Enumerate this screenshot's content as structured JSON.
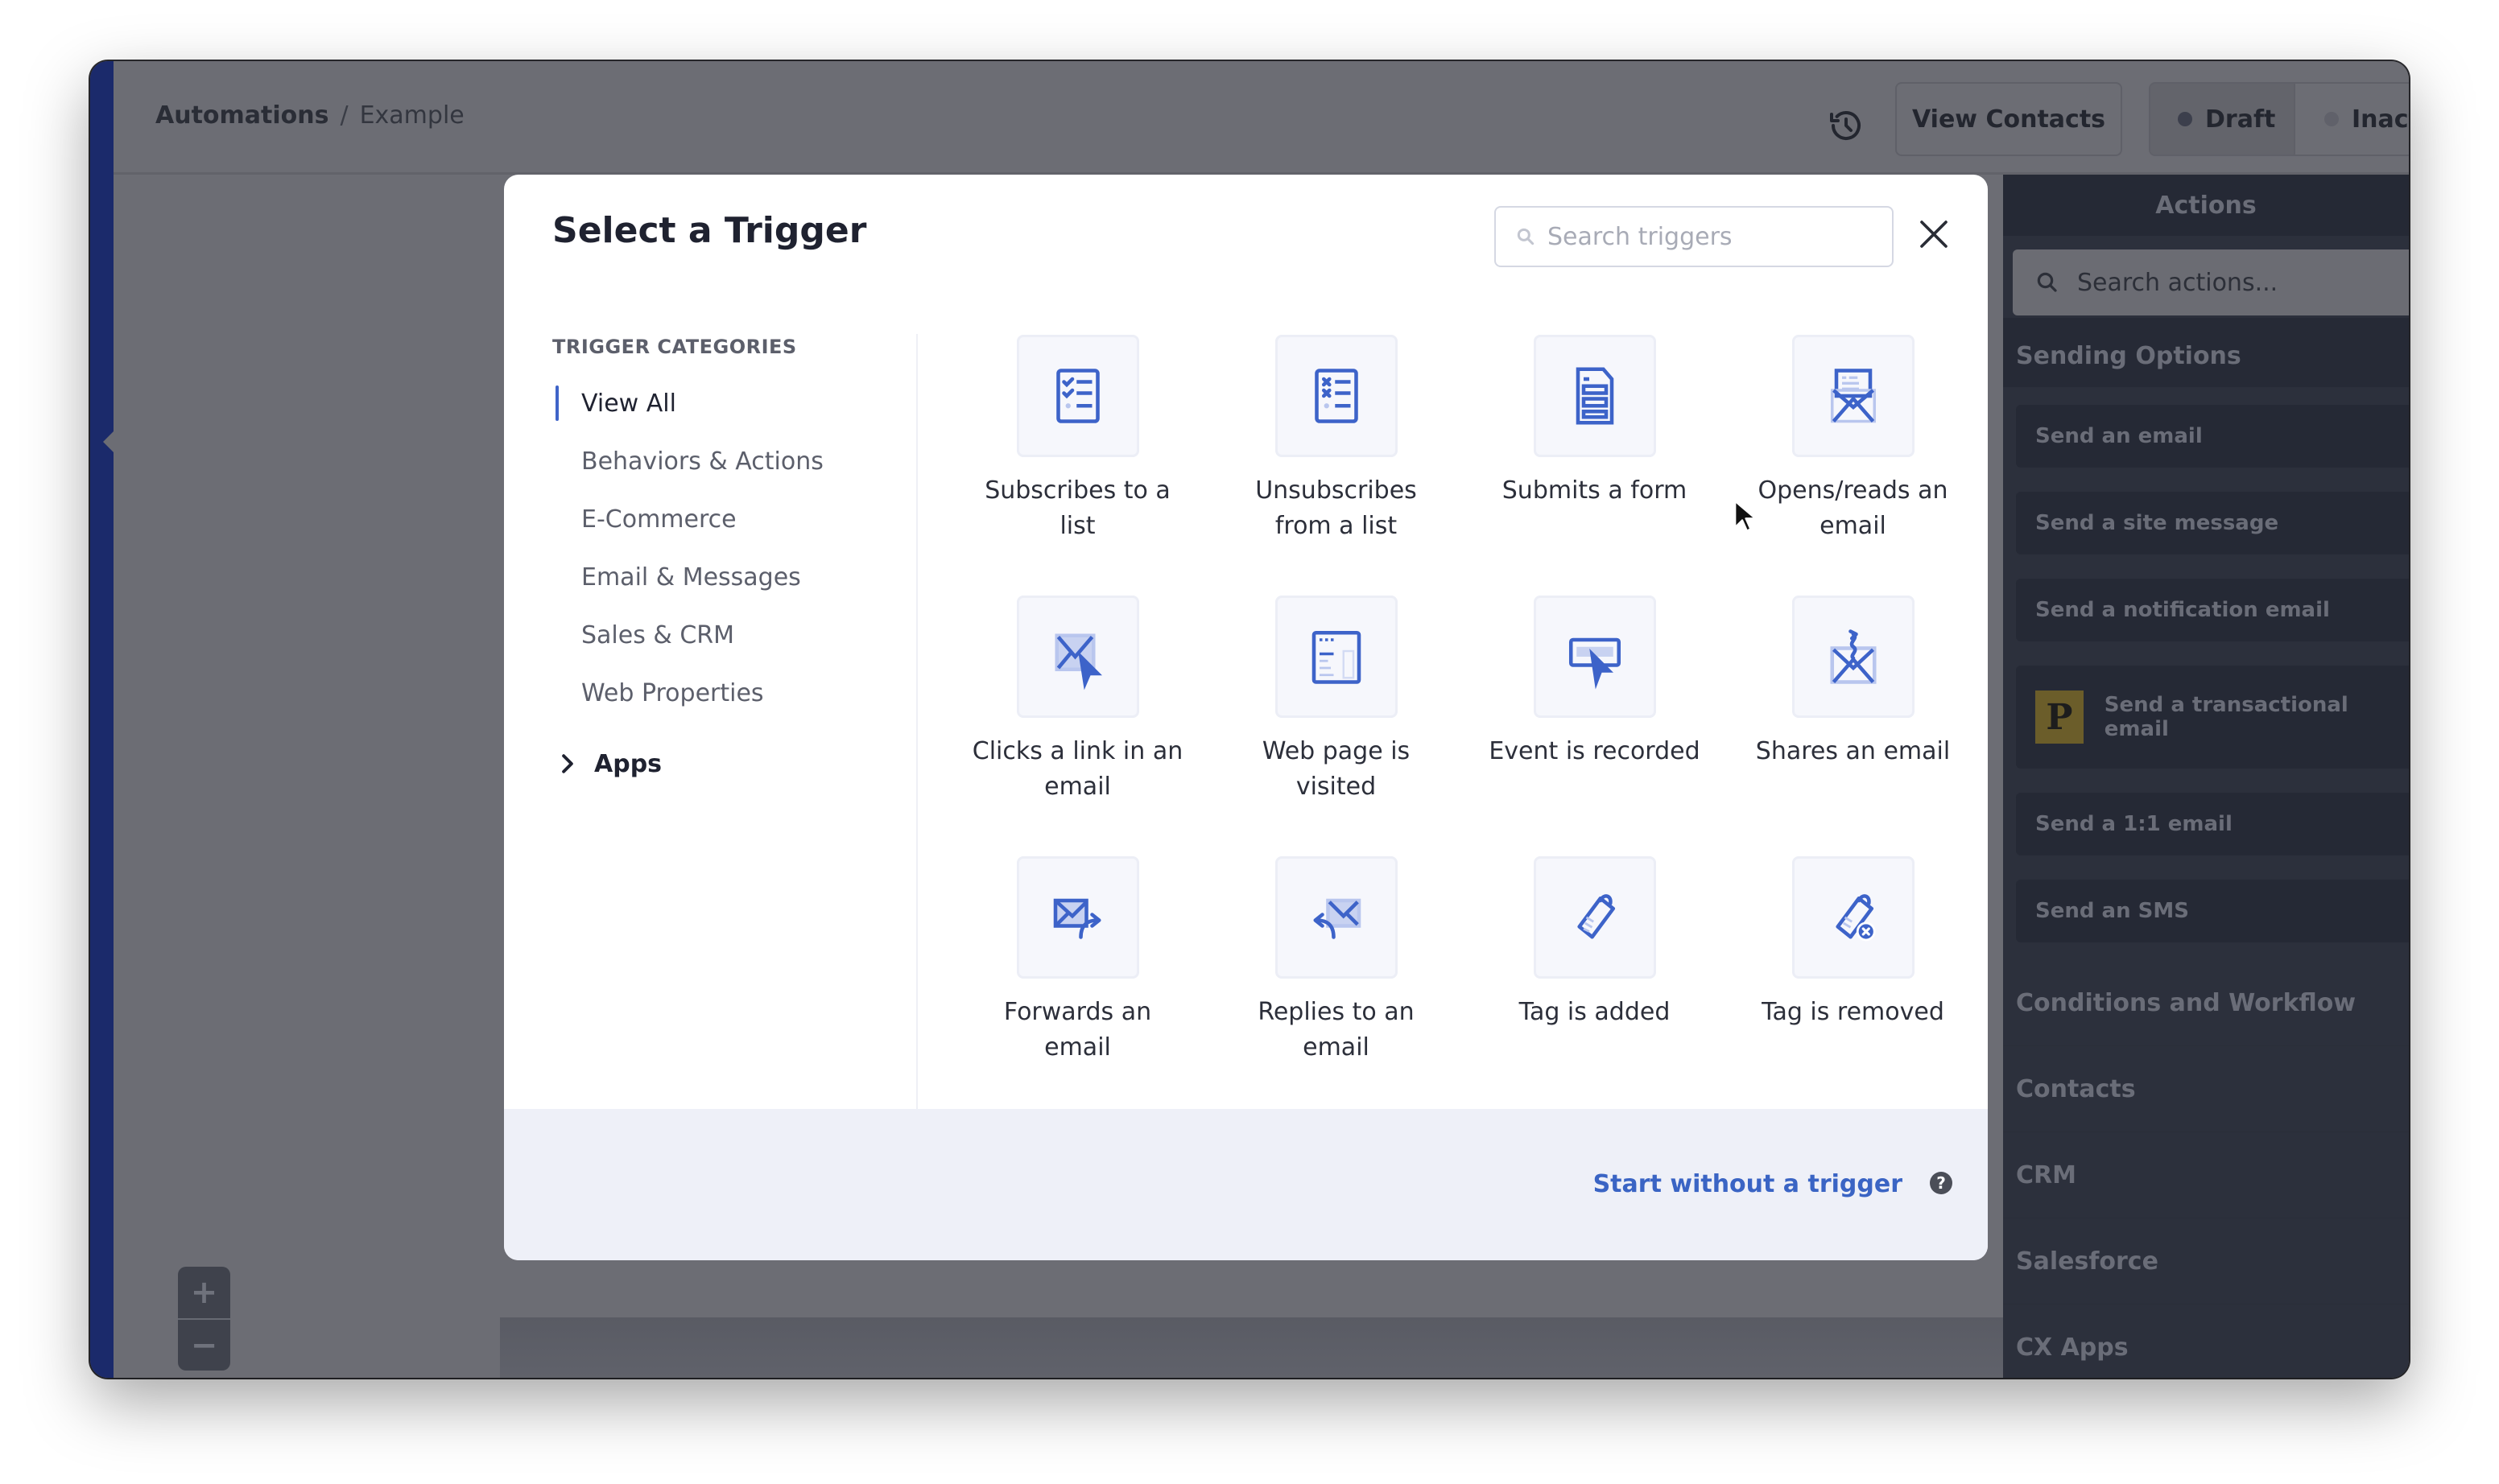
{
  "header": {
    "breadcrumb": {
      "root": "Automations",
      "separator": "/",
      "current": "Example"
    },
    "history_icon": "history-icon",
    "view_contacts_label": "View Contacts",
    "status_options": [
      {
        "label": "Draft",
        "selected": true
      },
      {
        "label": "Inactive",
        "selected": false
      }
    ]
  },
  "canvas": {
    "zoom_in_label": "+",
    "zoom_out_label": "−"
  },
  "actions_panel": {
    "title": "Actions",
    "search_placeholder": "Search actions...",
    "sending_options": {
      "title": "Sending Options",
      "items": [
        {
          "label": "Send an email"
        },
        {
          "label": "Send a site message"
        },
        {
          "label": "Send a notification email"
        },
        {
          "label": "Send a transactional email",
          "badge": "P",
          "badge_color": "#6b5d2a"
        },
        {
          "label": "Send a 1:1 email"
        },
        {
          "label": "Send an SMS"
        }
      ]
    },
    "sections": [
      "Conditions and Workflow",
      "Contacts",
      "CRM",
      "Salesforce",
      "CX Apps"
    ]
  },
  "modal": {
    "title": "Select a Trigger",
    "search_placeholder": "Search triggers",
    "search_value": "",
    "categories_heading": "TRIGGER CATEGORIES",
    "categories": [
      {
        "label": "View All",
        "active": true
      },
      {
        "label": "Behaviors & Actions",
        "active": false
      },
      {
        "label": "E-Commerce",
        "active": false
      },
      {
        "label": "Email & Messages",
        "active": false
      },
      {
        "label": "Sales & CRM",
        "active": false
      },
      {
        "label": "Web Properties",
        "active": false
      }
    ],
    "apps_label": "Apps",
    "triggers": [
      {
        "label": "Subscribes to a list",
        "icon": "list-check-icon"
      },
      {
        "label": "Unsubscribes from a list",
        "icon": "list-x-icon"
      },
      {
        "label": "Submits a form",
        "icon": "form-icon"
      },
      {
        "label": "Opens/reads an email",
        "icon": "open-envelope-icon"
      },
      {
        "label": "Clicks a link in an email",
        "icon": "envelope-click-icon"
      },
      {
        "label": "Web page is visited",
        "icon": "webpage-icon"
      },
      {
        "label": "Event is recorded",
        "icon": "event-click-icon"
      },
      {
        "label": "Shares an email",
        "icon": "share-envelope-icon"
      },
      {
        "label": "Forwards an email",
        "icon": "forward-envelope-icon"
      },
      {
        "label": "Replies to an email",
        "icon": "reply-envelope-icon"
      },
      {
        "label": "Tag is added",
        "icon": "tag-icon"
      },
      {
        "label": "Tag is removed",
        "icon": "tag-remove-icon"
      }
    ],
    "footer": {
      "start_without_label": "Start without a trigger",
      "help_label": "?"
    }
  },
  "colors": {
    "accent": "#3f64c8",
    "link": "#3a64c4",
    "icon_blue": "#3d63c9",
    "icon_light": "#b9c6ee",
    "rail": "#1b2a6b",
    "overlay": "#6c6d74",
    "panel_dark": "#2c303c"
  }
}
